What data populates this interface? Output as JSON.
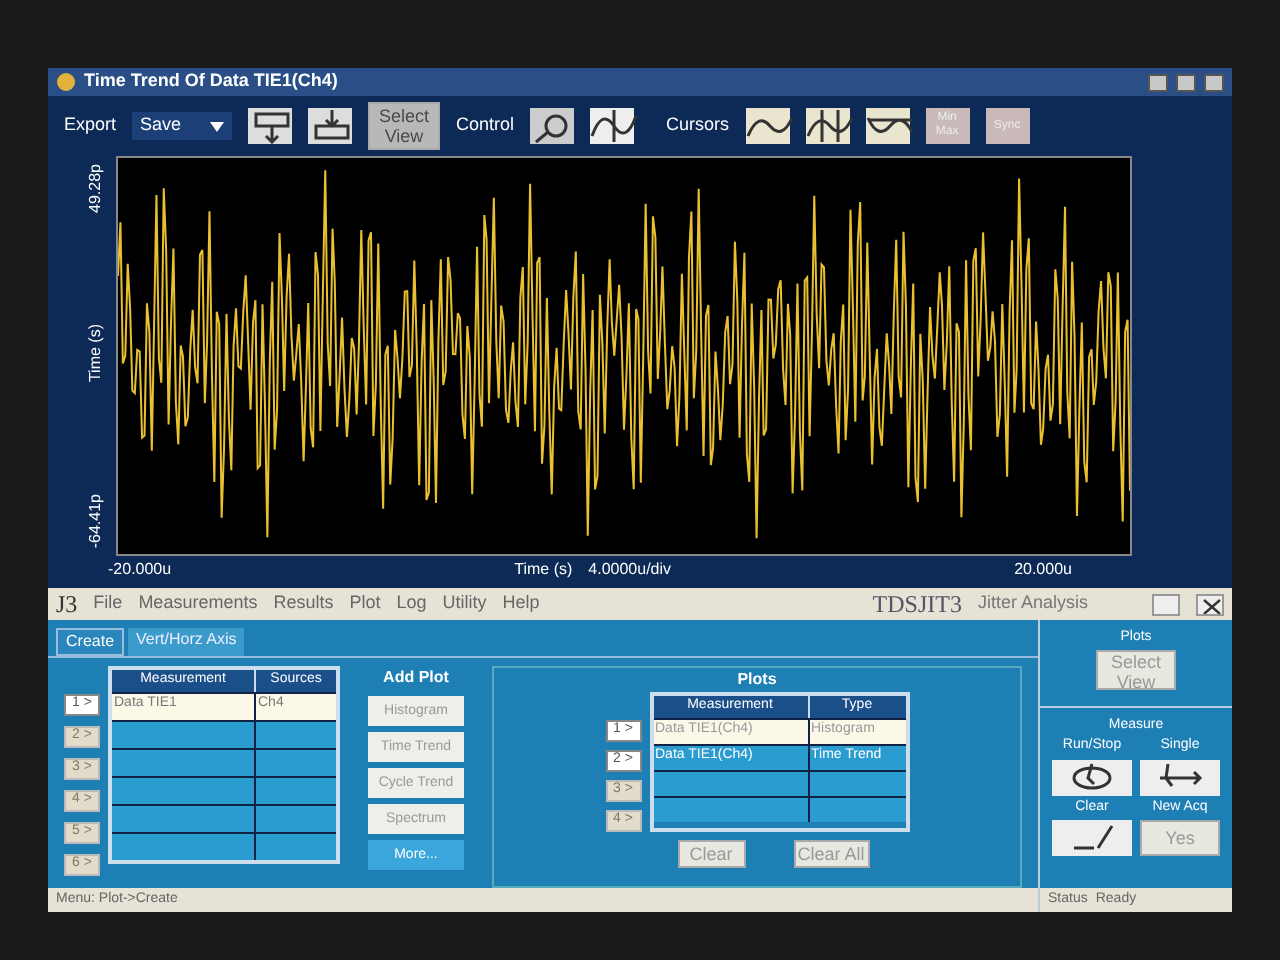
{
  "scope_window": {
    "title": "Time Trend Of Data TIE1(Ch4)",
    "export_label": "Export",
    "export_value": "Save",
    "select_view": "Select View",
    "control_label": "Control",
    "cursors_label": "Cursors",
    "cursor_buttons": [
      {
        "disabled": false
      },
      {
        "disabled": false
      },
      {
        "disabled": false
      },
      {
        "label": "Min Max",
        "disabled": true
      },
      {
        "label": "Sync",
        "disabled": true
      }
    ]
  },
  "plot": {
    "y_max": "49.28p",
    "y_min": "-64.41p",
    "y_label": "Time (s)",
    "x_min": "-20.000u",
    "x_max": "20.000u",
    "x_label": "Time (s)",
    "x_scale": "4.0000u/div"
  },
  "app": {
    "logo": "J3",
    "menu": [
      "File",
      "Measurements",
      "Results",
      "Plot",
      "Log",
      "Utility",
      "Help"
    ],
    "product": "TDSJIT3",
    "subtitle": "Jitter Analysis",
    "tabs": [
      {
        "label": "Create",
        "selected": true
      },
      {
        "label": "Vert/Horz Axis",
        "selected": false
      }
    ],
    "measurements": {
      "columns": [
        "Measurement",
        "Sources"
      ],
      "rows": [
        {
          "slot": "1 >",
          "enabled": true,
          "selected": true,
          "measurement": "Data TIE1",
          "source": "Ch4"
        },
        {
          "slot": "2 >",
          "enabled": false,
          "selected": false
        },
        {
          "slot": "3 >",
          "enabled": false,
          "selected": false
        },
        {
          "slot": "4 >",
          "enabled": false,
          "selected": false
        },
        {
          "slot": "5 >",
          "enabled": false,
          "selected": false
        },
        {
          "slot": "6 >",
          "enabled": false,
          "selected": false
        }
      ]
    },
    "add_plot": {
      "title": "Add Plot",
      "buttons": [
        {
          "label": "Histogram",
          "selected": false
        },
        {
          "label": "Time Trend",
          "selected": false
        },
        {
          "label": "Cycle Trend",
          "selected": false
        },
        {
          "label": "Spectrum",
          "selected": false
        },
        {
          "label": "More...",
          "selected": true
        }
      ]
    },
    "plots": {
      "title": "Plots",
      "columns": [
        "Measurement",
        "Type"
      ],
      "rows": [
        {
          "slot": "1 >",
          "enabled": true,
          "selected": true,
          "measurement": "Data TIE1(Ch4)",
          "type": "Histogram"
        },
        {
          "slot": "2 >",
          "enabled": true,
          "selected": false,
          "measurement": "Data TIE1(Ch4)",
          "type": "Time Trend"
        },
        {
          "slot": "3 >",
          "enabled": false,
          "selected": false
        },
        {
          "slot": "4 >",
          "enabled": false,
          "selected": false
        }
      ],
      "clear": "Clear",
      "clear_all": "Clear All"
    },
    "side": {
      "plots_title": "Plots",
      "select_view": "Select View",
      "measure_title": "Measure",
      "run_stop": "Run/Stop",
      "single": "Single",
      "clear": "Clear",
      "new_acq": "New Acq",
      "new_acq_value": "Yes"
    },
    "status": {
      "menu": "Menu: Plot->Create",
      "label": "Status",
      "value": "Ready"
    }
  }
}
